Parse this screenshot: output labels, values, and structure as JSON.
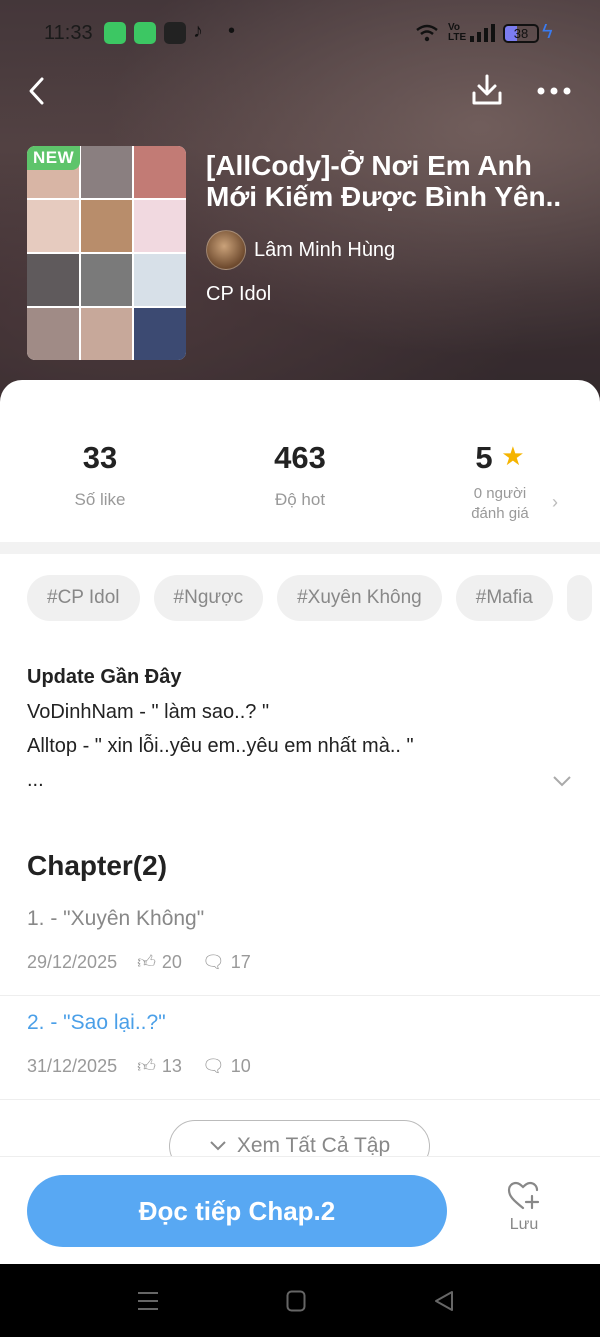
{
  "status_bar": {
    "time": "11:33",
    "battery": "38"
  },
  "book": {
    "badge": "NEW",
    "title": "[AllCody]-Ở Nơi Em Anh Mới Kiếm Được Bình Yên..",
    "author": "Lâm Minh Hùng",
    "genre": "CP Idol"
  },
  "stats": {
    "likes": {
      "value": "33",
      "label": "Số like"
    },
    "hot": {
      "value": "463",
      "label": "Độ hot"
    },
    "rating": {
      "value": "5",
      "label_line1": "0 người",
      "label_line2": "đánh giá"
    }
  },
  "tags": [
    "#CP Idol",
    "#Ngược",
    "#Xuyên Không",
    "#Mafia"
  ],
  "update": {
    "heading": "Update Gần Đây",
    "lines": [
      "VoDinhNam - \" làm sao..? \"",
      "Alltop - \" xin lỗi..yêu em..yêu em nhất mà.. \"",
      "..."
    ]
  },
  "chapters": {
    "heading": "Chapter(2)",
    "items": [
      {
        "title": "1. - \"Xuyên Không\"",
        "date": "29/12/2025",
        "likes": "20",
        "comments": "17",
        "color": "#888888"
      },
      {
        "title": "2. - \"Sao lại..?\"",
        "date": "31/12/2025",
        "likes": "13",
        "comments": "10",
        "color": "#4a9fe8"
      }
    ],
    "see_all": "Xem  Tất  Cả  Tập"
  },
  "actions": {
    "read_label": "Đọc tiếp Chap.2",
    "save_label": "Lưu"
  },
  "colors": {
    "accent": "#58a8f3",
    "star": "#f5b400",
    "badge": "#5ec46b"
  }
}
